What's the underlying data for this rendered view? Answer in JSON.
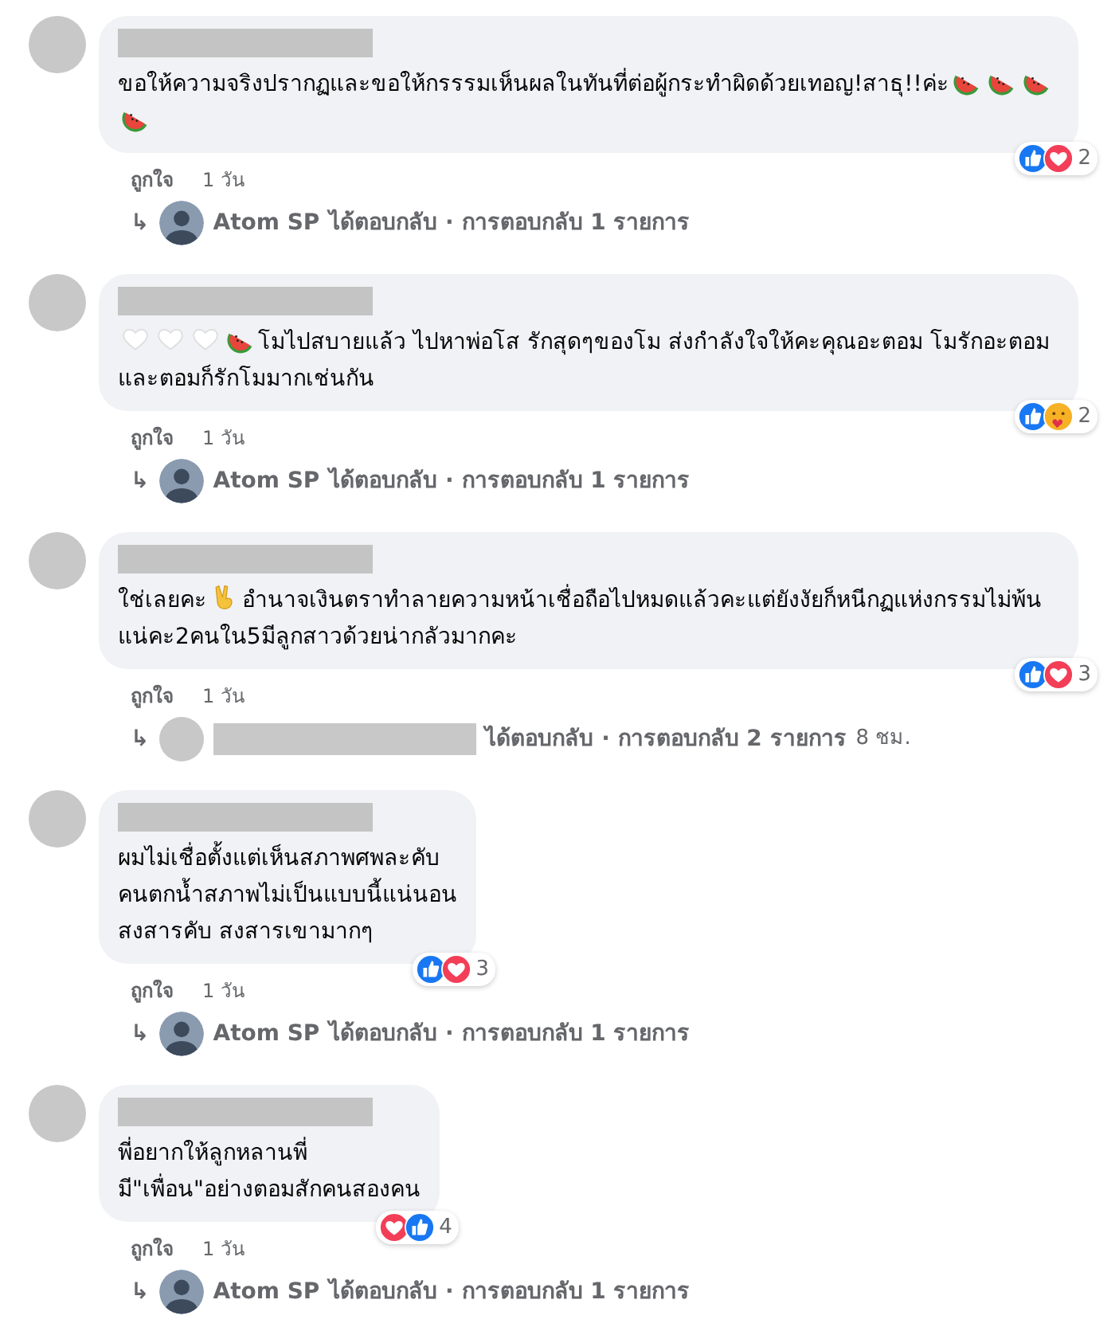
{
  "comments": [
    {
      "author": {
        "redacted": true
      },
      "body": [
        {
          "kind": "text",
          "text": "ขอให้ความจริงปรากฏและขอให้กรรรมเห็นผลในทันที่ต่อผู้กระทำผิดด้วยเทอญ!สาธุ!!ค่ะ"
        },
        {
          "kind": "watermelon"
        },
        {
          "kind": "watermelon"
        },
        {
          "kind": "watermelon"
        },
        {
          "kind": "watermelon"
        }
      ],
      "reactions": [
        {
          "kind": "like"
        },
        {
          "kind": "love"
        }
      ],
      "reaction_count": "2",
      "like_label": "ถูกใจ",
      "time": "1 วัน",
      "reply": {
        "arrow": "↳",
        "replier": {
          "name": "Atom SP",
          "redacted": false
        },
        "text": "ได้ตอบกลับ · การตอบกลับ 1 รายการ"
      }
    },
    {
      "author": {
        "redacted": true
      },
      "body": [
        {
          "kind": "white-heart"
        },
        {
          "kind": "white-heart"
        },
        {
          "kind": "white-heart"
        },
        {
          "kind": "watermelon"
        },
        {
          "kind": "text",
          "text": "โมไปสบายแล้ว ไปหาพ่อโส รักสุดๆของโม ส่งกำลังใจให้คะคุณอะตอม โมรักอะตอมและตอมก็รักโมมากเช่นกัน"
        }
      ],
      "reactions": [
        {
          "kind": "like"
        },
        {
          "kind": "care"
        }
      ],
      "reaction_count": "2",
      "like_label": "ถูกใจ",
      "time": "1 วัน",
      "reply": {
        "arrow": "↳",
        "replier": {
          "name": "Atom SP",
          "redacted": false
        },
        "text": "ได้ตอบกลับ · การตอบกลับ 1 รายการ"
      }
    },
    {
      "author": {
        "redacted": true
      },
      "body": [
        {
          "kind": "text",
          "text": "ใช่เลยคะ"
        },
        {
          "kind": "victory-hand"
        },
        {
          "kind": "text",
          "text": "อำนาจเงินตราทำลายความหน้าเชื่อถือไปหมดแล้วคะแต่ยังงัยก็หนีกฏแห่งกรรมไม่พ้นแน่คะ2คนใน5มีลูกสาวด้วยน่ากลัวมากคะ"
        }
      ],
      "reactions": [
        {
          "kind": "like"
        },
        {
          "kind": "love"
        }
      ],
      "reaction_count": "3",
      "like_label": "ถูกใจ",
      "time": "1 วัน",
      "reply": {
        "arrow": "↳",
        "replier": {
          "redacted": true
        },
        "text": "ได้ตอบกลับ · การตอบกลับ 2 รายการ",
        "time": "8 ชม."
      }
    },
    {
      "author": {
        "redacted": true
      },
      "body": [
        {
          "kind": "text",
          "text": "ผมไม่เชื่อตั้งแต่เห็นสภาพศพละคับ\nคนตกน้ำสภาพไม่เป็นแบบนี้แน่นอน\nสงสารคับ สงสารเขามากๆ"
        }
      ],
      "reactions": [
        {
          "kind": "like"
        },
        {
          "kind": "love"
        }
      ],
      "reaction_count": "3",
      "like_label": "ถูกใจ",
      "time": "1 วัน",
      "reply": {
        "arrow": "↳",
        "replier": {
          "name": "Atom SP",
          "redacted": false
        },
        "text": "ได้ตอบกลับ · การตอบกลับ 1 รายการ"
      }
    },
    {
      "author": {
        "redacted": true
      },
      "body": [
        {
          "kind": "text",
          "text": "พี่อยากให้ลูกหลานพี่\nมี\"เพื่อน\"อย่างตอมสักคนสองคน"
        }
      ],
      "reactions": [
        {
          "kind": "love"
        },
        {
          "kind": "like"
        }
      ],
      "reaction_count": "4",
      "like_label": "ถูกใจ",
      "time": "1 วัน",
      "reply": {
        "arrow": "↳",
        "replier": {
          "name": "Atom SP",
          "redacted": false
        },
        "text": "ได้ตอบกลับ · การตอบกลับ 1 รายการ"
      }
    }
  ]
}
